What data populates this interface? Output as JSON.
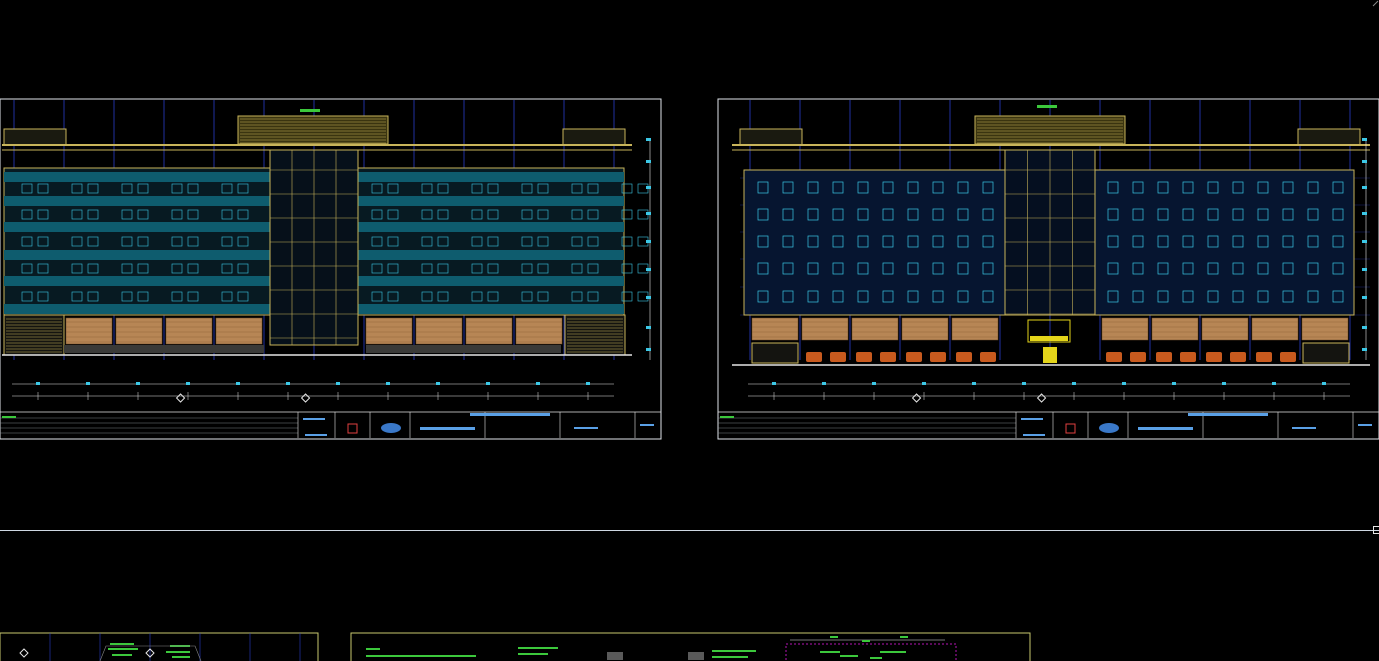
{
  "viewport": {
    "background_color": "#000000",
    "crosshair_color": "#cfd8e3"
  },
  "sheets": [
    {
      "id": "elevation-rear",
      "frame_color": "#dfe4ea",
      "wall_color": "#0e5c6e",
      "accent_color": "#c8b45a",
      "brick_color": "#b78655"
    },
    {
      "id": "elevation-front",
      "frame_color": "#dfe4ea",
      "wall_color": "#0a1e3c",
      "accent_color": "#c8b45a",
      "brick_color": "#b78655",
      "door_color": "#e4d51a",
      "planter_color": "#c85a1e"
    }
  ],
  "lower_sheets": [
    {
      "id": "detail-sheet-left",
      "frame_color": "#c8c86e"
    },
    {
      "id": "detail-sheet-right",
      "frame_color": "#c8c86e",
      "highlight_color": "#b414b4"
    }
  ],
  "colors": {
    "grid_blue": "#2a3cc8",
    "cyan": "#3cc8e6",
    "green": "#3cc83c",
    "olive": "#c8b45a",
    "white": "#e6e6e6"
  }
}
